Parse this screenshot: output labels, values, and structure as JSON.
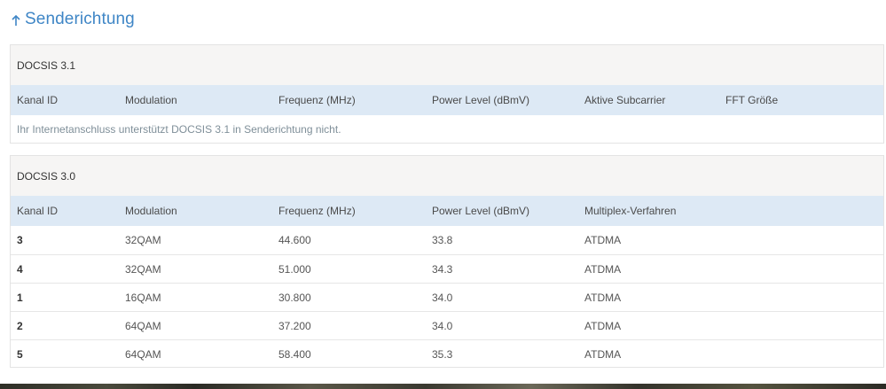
{
  "section": {
    "title": "Senderichtung"
  },
  "docsis31": {
    "title": "DOCSIS 3.1",
    "columns": [
      "Kanal ID",
      "Modulation",
      "Frequenz (MHz)",
      "Power Level (dBmV)",
      "Aktive Subcarrier",
      "FFT Größe"
    ],
    "note": "Ihr Internetanschluss unterstützt DOCSIS 3.1 in Senderichtung nicht."
  },
  "docsis30": {
    "title": "DOCSIS 3.0",
    "columns": [
      "Kanal ID",
      "Modulation",
      "Frequenz (MHz)",
      "Power Level (dBmV)",
      "Multiplex-Verfahren"
    ],
    "rows": [
      [
        "3",
        "32QAM",
        "44.600",
        "33.8",
        "ATDMA"
      ],
      [
        "4",
        "32QAM",
        "51.000",
        "34.3",
        "ATDMA"
      ],
      [
        "1",
        "16QAM",
        "30.800",
        "34.0",
        "ATDMA"
      ],
      [
        "2",
        "64QAM",
        "37.200",
        "34.0",
        "ATDMA"
      ],
      [
        "5",
        "64QAM",
        "58.400",
        "35.3",
        "ATDMA"
      ]
    ]
  },
  "colors": {
    "accent": "#3f86c6",
    "header_row": "#dde9f5",
    "panel_title_bg": "#f6f5f4"
  }
}
